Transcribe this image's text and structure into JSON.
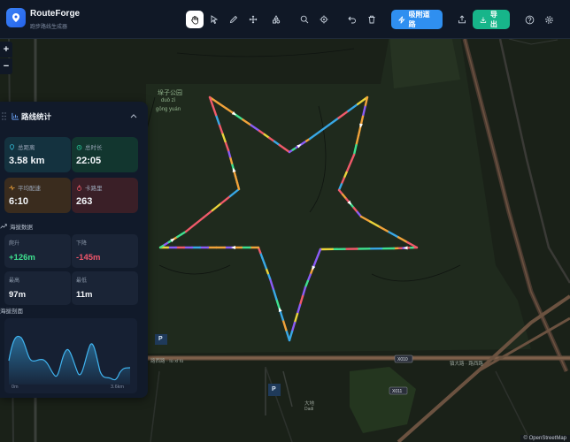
{
  "app": {
    "title": "RouteForge",
    "subtitle": "跑步路线生成器"
  },
  "toolbar": {
    "tools": [
      "hand-icon",
      "pointer-icon",
      "pen-icon",
      "move-icon",
      "shapes-icon",
      "search-icon",
      "target-icon",
      "undo-icon",
      "trash-icon"
    ],
    "snap_label": "吸附道路",
    "export_label": "导出"
  },
  "map_controls": {
    "zoom_in": "+",
    "zoom_out": "−"
  },
  "stats": {
    "title": "路线统计",
    "cards": [
      {
        "label": "总距离",
        "value": "3.58 km",
        "color": "#14323f",
        "icon_color": "#36c4e0"
      },
      {
        "label": "总时长",
        "value": "22:05",
        "color": "#12362f",
        "icon_color": "#27c99a"
      },
      {
        "label": "平均配速",
        "value": "6:10",
        "color": "#3a2c1e",
        "icon_color": "#f0a23a"
      },
      {
        "label": "卡路里",
        "value": "263",
        "color": "#3a1f27",
        "icon_color": "#f05a6a"
      }
    ],
    "elevation_title": "海拔数据",
    "elevation": [
      {
        "label": "爬升",
        "value": "+126m",
        "color": "#3ee08f"
      },
      {
        "label": "下降",
        "value": "-145m",
        "color": "#f0566b"
      },
      {
        "label": "最高",
        "value": "97m",
        "color": "#f3f6fa"
      },
      {
        "label": "最低",
        "value": "11m",
        "color": "#f3f6fa"
      }
    ],
    "profile_title": "海拔剖面",
    "profile_start": "0m",
    "profile_end": "3.6km"
  },
  "map": {
    "park_label": "垛子公园",
    "park_label_pinyin": "duǒ zǐ",
    "park_label_pinyin2": "gōng yuán",
    "road_label_1": "路西路 · lù xī lù",
    "road_label_2": "X010",
    "road_label_3": "X011",
    "road_label_4": "镇大路 · 路西路",
    "road_label_5": "大地",
    "road_label_6": "Dadi",
    "parking_label": "P",
    "attribution": "© OpenStreetMap"
  }
}
